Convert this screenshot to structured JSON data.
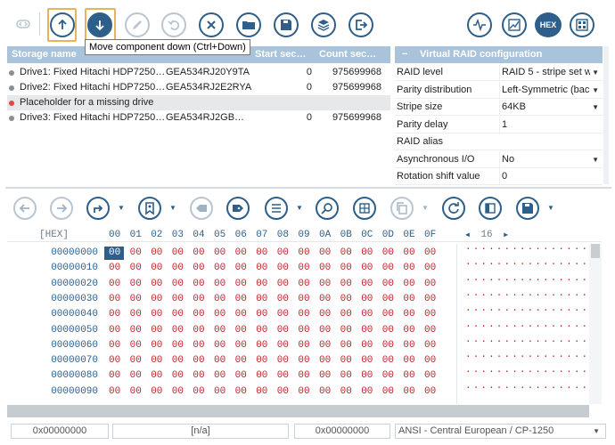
{
  "toolbar": {
    "tooltip": "Move component down (Ctrl+Down)",
    "hex_label": "HEX"
  },
  "storage_table": {
    "columns": [
      "Storage name",
      "Start sec…",
      "Count sec…"
    ],
    "rows": [
      {
        "name": "Drive1: Fixed Hitachi HDP7250…",
        "serial": "GEA534RJ20Y9TA",
        "start": "0",
        "count": "975699968",
        "status": "ok"
      },
      {
        "name": "Drive2: Fixed Hitachi HDP7250…",
        "serial": "GEA534RJ2E2RYA",
        "start": "0",
        "count": "975699968",
        "status": "ok"
      },
      {
        "name": "Placeholder for a missing drive",
        "serial": "",
        "start": "",
        "count": "",
        "status": "missing"
      },
      {
        "name": "Drive3: Fixed Hitachi HDP7250…",
        "serial": "GEA534RJ2GB…",
        "start": "0",
        "count": "975699968",
        "status": "ok"
      }
    ]
  },
  "raid_config": {
    "title": "Virtual RAID configuration",
    "collapse": "−",
    "properties": [
      {
        "key": "RAID level",
        "value": "RAID 5 - stripe set w",
        "dropdown": true
      },
      {
        "key": "Parity distribution",
        "value": "Left-Symmetric (bac",
        "dropdown": true
      },
      {
        "key": "Stripe size",
        "value": "64KB",
        "dropdown": true
      },
      {
        "key": "Parity delay",
        "value": "1",
        "dropdown": false
      },
      {
        "key": "RAID alias",
        "value": "",
        "dropdown": false
      },
      {
        "key": "Asynchronous I/O",
        "value": "No",
        "dropdown": true
      },
      {
        "key": "Rotation shift value",
        "value": "0",
        "dropdown": false
      }
    ]
  },
  "hex_view": {
    "header_label": "[HEX]",
    "columns": [
      "00",
      "01",
      "02",
      "03",
      "04",
      "05",
      "06",
      "07",
      "08",
      "09",
      "0A",
      "0B",
      "0C",
      "0D",
      "0E",
      "0F"
    ],
    "bytes_per_row": "16",
    "offsets": [
      "00000000",
      "00000010",
      "00000020",
      "00000030",
      "00000040",
      "00000050",
      "00000060",
      "00000070",
      "00000080",
      "00000090"
    ],
    "byte_value": "00",
    "ascii_row": "................"
  },
  "status_bar": {
    "offset1": "0x00000000",
    "value": "[n/a]",
    "offset2": "0x00000000",
    "encoding": "ANSI - Central European / CP-1250"
  }
}
